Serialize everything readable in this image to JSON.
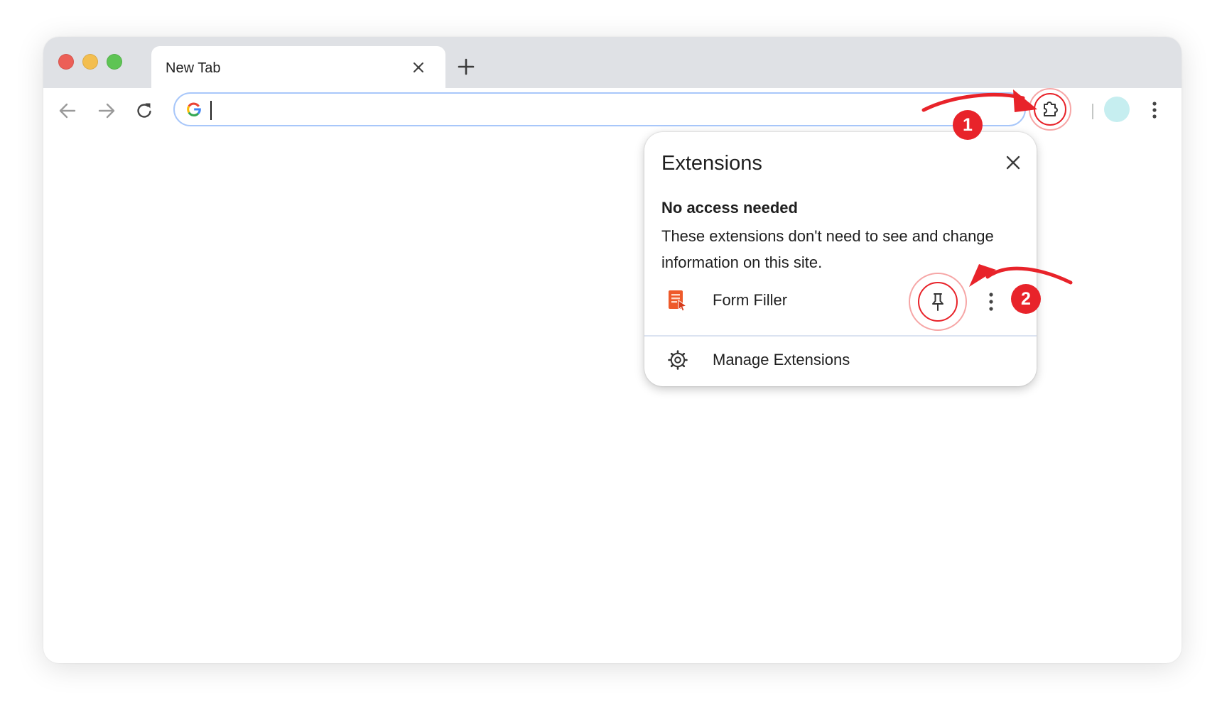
{
  "tab": {
    "title": "New Tab"
  },
  "omnibox": {
    "value": ""
  },
  "popup": {
    "title": "Extensions",
    "section_heading": "No access needed",
    "section_description": "These extensions don't need to see and change information on this site.",
    "extension_name": "Form Filler",
    "manage_label": "Manage Extensions"
  },
  "annotations": {
    "step1": "1",
    "step2": "2"
  },
  "colors": {
    "annotation_red": "#e8232a",
    "tabstrip": "#dfe1e5",
    "omnibox_border": "#a8c7fa",
    "avatar": "#c6eef0",
    "extension_icon": "#ee5a2b"
  },
  "icons": {
    "tab_close": "close-icon",
    "new_tab": "plus-icon",
    "back": "arrow-left-icon",
    "forward": "arrow-right-icon",
    "reload": "reload-icon",
    "search_engine": "google-g-icon",
    "extensions": "puzzle-icon",
    "profile": "avatar",
    "menu": "kebab-menu-icon",
    "pin": "pin-icon",
    "manage": "gear-icon"
  }
}
